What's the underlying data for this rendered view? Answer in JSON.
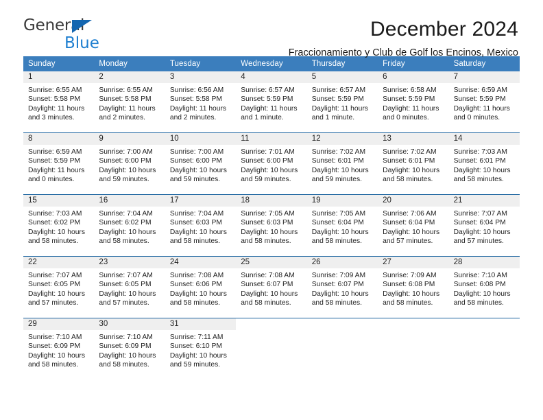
{
  "brand": {
    "name_top": "General",
    "name_bottom": "Blue",
    "triangle_color": "#1466b0",
    "text_color_top": "#3a3a3a",
    "text_color_bottom": "#1f7fd0"
  },
  "header": {
    "title": "December 2024",
    "subtitle": "Fraccionamiento y Club de Golf los Encinos, Mexico"
  },
  "theme": {
    "header_bg": "#3b7ebd",
    "header_text": "#ffffff",
    "week_divider": "#18619e",
    "daynum_bg": "#efefef",
    "cell_bg": "#ffffff",
    "body_text": "#222222"
  },
  "calendar": {
    "weekday_headers": [
      "Sunday",
      "Monday",
      "Tuesday",
      "Wednesday",
      "Thursday",
      "Friday",
      "Saturday"
    ],
    "weeks": [
      [
        {
          "day": "1",
          "info": "Sunrise: 6:55 AM\nSunset: 5:58 PM\nDaylight: 11 hours\nand 3 minutes."
        },
        {
          "day": "2",
          "info": "Sunrise: 6:55 AM\nSunset: 5:58 PM\nDaylight: 11 hours\nand 2 minutes."
        },
        {
          "day": "3",
          "info": "Sunrise: 6:56 AM\nSunset: 5:58 PM\nDaylight: 11 hours\nand 2 minutes."
        },
        {
          "day": "4",
          "info": "Sunrise: 6:57 AM\nSunset: 5:59 PM\nDaylight: 11 hours\nand 1 minute."
        },
        {
          "day": "5",
          "info": "Sunrise: 6:57 AM\nSunset: 5:59 PM\nDaylight: 11 hours\nand 1 minute."
        },
        {
          "day": "6",
          "info": "Sunrise: 6:58 AM\nSunset: 5:59 PM\nDaylight: 11 hours\nand 0 minutes."
        },
        {
          "day": "7",
          "info": "Sunrise: 6:59 AM\nSunset: 5:59 PM\nDaylight: 11 hours\nand 0 minutes."
        }
      ],
      [
        {
          "day": "8",
          "info": "Sunrise: 6:59 AM\nSunset: 5:59 PM\nDaylight: 11 hours\nand 0 minutes."
        },
        {
          "day": "9",
          "info": "Sunrise: 7:00 AM\nSunset: 6:00 PM\nDaylight: 10 hours\nand 59 minutes."
        },
        {
          "day": "10",
          "info": "Sunrise: 7:00 AM\nSunset: 6:00 PM\nDaylight: 10 hours\nand 59 minutes."
        },
        {
          "day": "11",
          "info": "Sunrise: 7:01 AM\nSunset: 6:00 PM\nDaylight: 10 hours\nand 59 minutes."
        },
        {
          "day": "12",
          "info": "Sunrise: 7:02 AM\nSunset: 6:01 PM\nDaylight: 10 hours\nand 59 minutes."
        },
        {
          "day": "13",
          "info": "Sunrise: 7:02 AM\nSunset: 6:01 PM\nDaylight: 10 hours\nand 58 minutes."
        },
        {
          "day": "14",
          "info": "Sunrise: 7:03 AM\nSunset: 6:01 PM\nDaylight: 10 hours\nand 58 minutes."
        }
      ],
      [
        {
          "day": "15",
          "info": "Sunrise: 7:03 AM\nSunset: 6:02 PM\nDaylight: 10 hours\nand 58 minutes."
        },
        {
          "day": "16",
          "info": "Sunrise: 7:04 AM\nSunset: 6:02 PM\nDaylight: 10 hours\nand 58 minutes."
        },
        {
          "day": "17",
          "info": "Sunrise: 7:04 AM\nSunset: 6:03 PM\nDaylight: 10 hours\nand 58 minutes."
        },
        {
          "day": "18",
          "info": "Sunrise: 7:05 AM\nSunset: 6:03 PM\nDaylight: 10 hours\nand 58 minutes."
        },
        {
          "day": "19",
          "info": "Sunrise: 7:05 AM\nSunset: 6:04 PM\nDaylight: 10 hours\nand 58 minutes."
        },
        {
          "day": "20",
          "info": "Sunrise: 7:06 AM\nSunset: 6:04 PM\nDaylight: 10 hours\nand 57 minutes."
        },
        {
          "day": "21",
          "info": "Sunrise: 7:07 AM\nSunset: 6:04 PM\nDaylight: 10 hours\nand 57 minutes."
        }
      ],
      [
        {
          "day": "22",
          "info": "Sunrise: 7:07 AM\nSunset: 6:05 PM\nDaylight: 10 hours\nand 57 minutes."
        },
        {
          "day": "23",
          "info": "Sunrise: 7:07 AM\nSunset: 6:05 PM\nDaylight: 10 hours\nand 57 minutes."
        },
        {
          "day": "24",
          "info": "Sunrise: 7:08 AM\nSunset: 6:06 PM\nDaylight: 10 hours\nand 58 minutes."
        },
        {
          "day": "25",
          "info": "Sunrise: 7:08 AM\nSunset: 6:07 PM\nDaylight: 10 hours\nand 58 minutes."
        },
        {
          "day": "26",
          "info": "Sunrise: 7:09 AM\nSunset: 6:07 PM\nDaylight: 10 hours\nand 58 minutes."
        },
        {
          "day": "27",
          "info": "Sunrise: 7:09 AM\nSunset: 6:08 PM\nDaylight: 10 hours\nand 58 minutes."
        },
        {
          "day": "28",
          "info": "Sunrise: 7:10 AM\nSunset: 6:08 PM\nDaylight: 10 hours\nand 58 minutes."
        }
      ],
      [
        {
          "day": "29",
          "info": "Sunrise: 7:10 AM\nSunset: 6:09 PM\nDaylight: 10 hours\nand 58 minutes."
        },
        {
          "day": "30",
          "info": "Sunrise: 7:10 AM\nSunset: 6:09 PM\nDaylight: 10 hours\nand 58 minutes."
        },
        {
          "day": "31",
          "info": "Sunrise: 7:11 AM\nSunset: 6:10 PM\nDaylight: 10 hours\nand 59 minutes."
        },
        {
          "day": "",
          "info": ""
        },
        {
          "day": "",
          "info": ""
        },
        {
          "day": "",
          "info": ""
        },
        {
          "day": "",
          "info": ""
        }
      ]
    ]
  }
}
